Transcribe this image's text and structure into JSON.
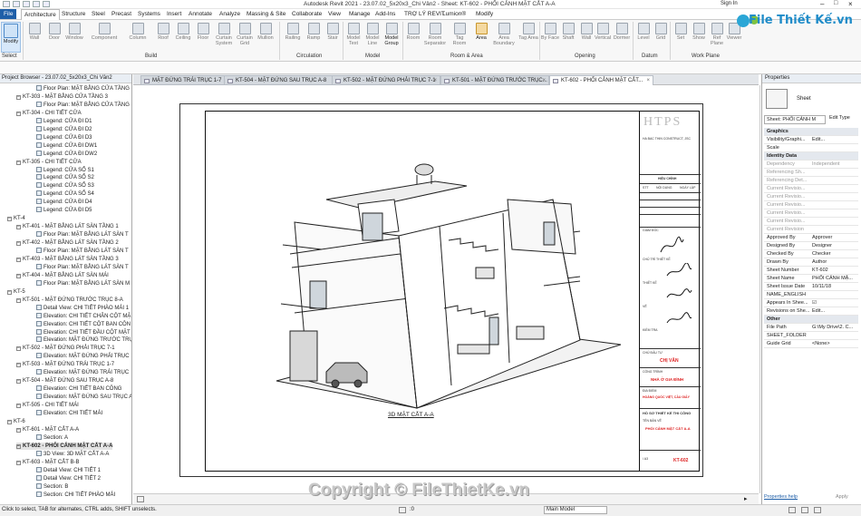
{
  "titlebar": {
    "title": "Autodesk Revit 2021 - 23.07.02_5x20x3_Chi Vân2 - Sheet: KT-602 - PHỐI CẢNH MẶT CẮT A-A",
    "signin": "Sign In"
  },
  "menu": [
    "File",
    "Architecture",
    "Structure",
    "Steel",
    "Precast",
    "Systems",
    "Insert",
    "Annotate",
    "Analyze",
    "Massing & Site",
    "Collaborate",
    "View",
    "Manage",
    "Add-Ins",
    "TRỢ LÝ REVIT",
    "Lumion®",
    "Modify"
  ],
  "ribbon": {
    "tools": [
      "Modify",
      "Wall",
      "Door",
      "Window",
      "Component",
      "Column",
      "Roof",
      "Ceiling",
      "Floor",
      "Curtain System",
      "Curtain Grid",
      "Mullion",
      "Railing",
      "Ramp",
      "Stair",
      "Model Text",
      "Model Line",
      "Model Group",
      "Room",
      "Room Separator",
      "Tag Room",
      "Area",
      "Area Boundary",
      "Tag Area",
      "By Face",
      "Shaft",
      "Wall",
      "Vertical",
      "Dormer",
      "Level",
      "Grid",
      "Set",
      "Show",
      "Ref Plane",
      "Viewer"
    ],
    "groups": [
      "Select",
      "Build",
      "Circulation",
      "Model",
      "Room & Area",
      "Opening",
      "Datum",
      "Work Plane"
    ]
  },
  "logo": {
    "text": "File Thiết Kế.vn"
  },
  "project_browser": {
    "title": "Project Browser - 23.07.02_5x20x3_Chi Vân2",
    "items": [
      "Floor Plan: MẶT BẰNG CỬA TẦNG",
      "KT-303 - MẶT BẰNG CỬA TẦNG 3",
      "Floor Plan: MẶT BẰNG CỬA TẦNG",
      "KT-304 - CHI TIẾT CỬA",
      "Legend: CỬA ĐI D1",
      "Legend: CỬA ĐI D2",
      "Legend: CỬA ĐI D3",
      "Legend: CỬA ĐI DW1",
      "Legend: CỬA ĐI DW2",
      "KT-305 - CHI TIẾT CỬA",
      "Legend: CỬA SỔ S1",
      "Legend: CỬA SỔ S2",
      "Legend: CỬA SỔ S3",
      "Legend: CỬA SỔ S4",
      "Legend: CỬA ĐI D4",
      "Legend: CỬA ĐI D5",
      "KT-4",
      "KT-401 - MẶT BẰNG LÁT SÀN TẦNG 1",
      "Floor Plan: MẶT BẰNG LÁT SÀN T",
      "KT-402 - MẶT BẰNG LÁT SÀN TẦNG 2",
      "Floor Plan: MẶT BẰNG LÁT SÀN T",
      "KT-403 - MẶT BẰNG LÁT SÀN TẦNG 3",
      "Floor Plan: MẶT BẰNG LÁT SÀN T",
      "KT-404 - MẶT BẰNG LÁT SÀN MÁI",
      "Floor Plan: MẶT BẰNG LÁT SÀN M",
      "KT-5",
      "KT-501 - MẶT ĐỨNG TRƯỚC TRỤC 8-A",
      "Detail View: CHI TIẾT PHÀO MÁI 1",
      "Elevation: CHI TIẾT CHÂN CỘT MẶ",
      "Elevation: CHI TIẾT CỘT BAN CÔN",
      "Elevation: CHI TIẾT ĐẦU CỘT MẶT",
      "Elevation: MẶT ĐỨNG TRƯỚC TRỤ",
      "KT-502 - MẶT ĐỨNG PHẢI TRỤC 7-1",
      "Elevation: MẶT ĐỨNG PHẢI TRỤC",
      "KT-503 - MẶT ĐỨNG TRÁI TRỤC 1-7",
      "Elevation: MẶT ĐỨNG TRÁI TRỤC",
      "KT-504 - MẶT ĐỨNG SAU TRỤC A-8",
      "Elevation: CHI TIẾT BAN CÔNG",
      "Elevation: MẶT ĐỨNG SAU TRỤC A",
      "KT-505 - CHI TIẾT MÁI",
      "Elevation: CHI TIẾT MÁI",
      "KT-6",
      "KT-601 - MẶT CẮT A-A",
      "Section: A",
      "KT-602 - PHỐI CẢNH MẶT CẮT A-A",
      "3D View: 3D MẶT CẮT A-A",
      "KT-603 - MẶT CẮT B-B",
      "Detail View: CHI TIẾT 1",
      "Detail View: CHI TIẾT 2",
      "Section: B",
      "Section: CHI TIẾT PHÀO MÁI"
    ]
  },
  "tabs": [
    "MẶT ĐỨNG TRÁI TRỤC 1-7",
    "KT-504 - MẶT ĐỨNG SAU TRỤC A-8",
    "KT-502 - MẶT ĐỨNG PHẢI TRỤC 7-1",
    "KT-501 - MẶT ĐỨNG TRƯỚC TRỤC...",
    "KT-602 - PHỐI CẢNH MẶT CẮT..."
  ],
  "drawing": {
    "view_title": "3D MẶT CẮT A-A"
  },
  "title_block": {
    "firm": "HTPS",
    "firm_sub": "HA BAC THIN CONSTRUCT, JSC",
    "rev_header": "HIỆU CHỈNH",
    "rev_cols": [
      "STT",
      "NỘI DUNG",
      "NGÀY LẬP"
    ],
    "owner_label": "CHỦ ĐẦU TƯ",
    "owner": "CHỊ VÂN",
    "project_label": "CÔNG TRÌNH",
    "project": "NHÀ Ở GIA ĐÌNH",
    "address_label": "ĐỊA ĐIỂM",
    "address": "HOÀNG QUỐC VIỆT, CẦU GIẤY",
    "sheet_title_label": "HỒ SƠ THIẾT KẾ THI CÔNG",
    "drawing_name_label": "TÊN BẢN VẼ",
    "drawing_name": "PHỐI CẢNH MẶT CẮT A-A",
    "scale": "/ A3",
    "sheet_no": "KT-602",
    "roles": [
      "GIÁM ĐỐC",
      "CHỦ TRÌ THIẾT KẾ",
      "THIẾT KẾ",
      "VẼ",
      "KIỂM TRA"
    ]
  },
  "properties": {
    "title": "Properties",
    "type": "Sheet",
    "instance": "Sheet: PHỐI CẢNH M",
    "edit_type": "Edit Type",
    "rows": [
      {
        "k": "Graphics",
        "v": "",
        "sec": true
      },
      {
        "k": "Visibility/Graphi...",
        "v": "Edit..."
      },
      {
        "k": "Scale",
        "v": ""
      },
      {
        "k": "Identity Data",
        "v": "",
        "sec": true
      },
      {
        "k": "Dependency",
        "v": "Independent",
        "dim": true
      },
      {
        "k": "Referencing Sh...",
        "v": "",
        "dim": true
      },
      {
        "k": "Referencing Det...",
        "v": "",
        "dim": true
      },
      {
        "k": "Current Revisio...",
        "v": "",
        "dim": true
      },
      {
        "k": "Current Revisio...",
        "v": "",
        "dim": true
      },
      {
        "k": "Current Revisio...",
        "v": "",
        "dim": true
      },
      {
        "k": "Current Revisio...",
        "v": "",
        "dim": true
      },
      {
        "k": "Current Revisio...",
        "v": "",
        "dim": true
      },
      {
        "k": "Current Revision",
        "v": "",
        "dim": true
      },
      {
        "k": "Approved By",
        "v": "Approver"
      },
      {
        "k": "Designed By",
        "v": "Designer"
      },
      {
        "k": "Checked By",
        "v": "Checker"
      },
      {
        "k": "Drawn By",
        "v": "Author"
      },
      {
        "k": "Sheet Number",
        "v": "KT-602"
      },
      {
        "k": "Sheet Name",
        "v": "PHỐI CẢNH MẶ..."
      },
      {
        "k": "Sheet Issue Date",
        "v": "10/11/18"
      },
      {
        "k": "NAME_ENGLISH",
        "v": ""
      },
      {
        "k": "Appears In Shee...",
        "v": "☑"
      },
      {
        "k": "Revisions on She...",
        "v": "Edit..."
      },
      {
        "k": "Other",
        "v": "",
        "sec": true
      },
      {
        "k": "File Path",
        "v": "G:\\My Drive\\2. C..."
      },
      {
        "k": "SHEET_FOLDER",
        "v": ""
      },
      {
        "k": "Guide Grid",
        "v": "<None>"
      }
    ],
    "help": "Properties help",
    "apply": "Apply"
  },
  "status": {
    "hint": "Click to select, TAB for alternates, CTRL adds, SHIFT unselects.",
    "zero": ":0",
    "model": "Main Model"
  },
  "watermark": "Copyright © FileThietKe.vn"
}
